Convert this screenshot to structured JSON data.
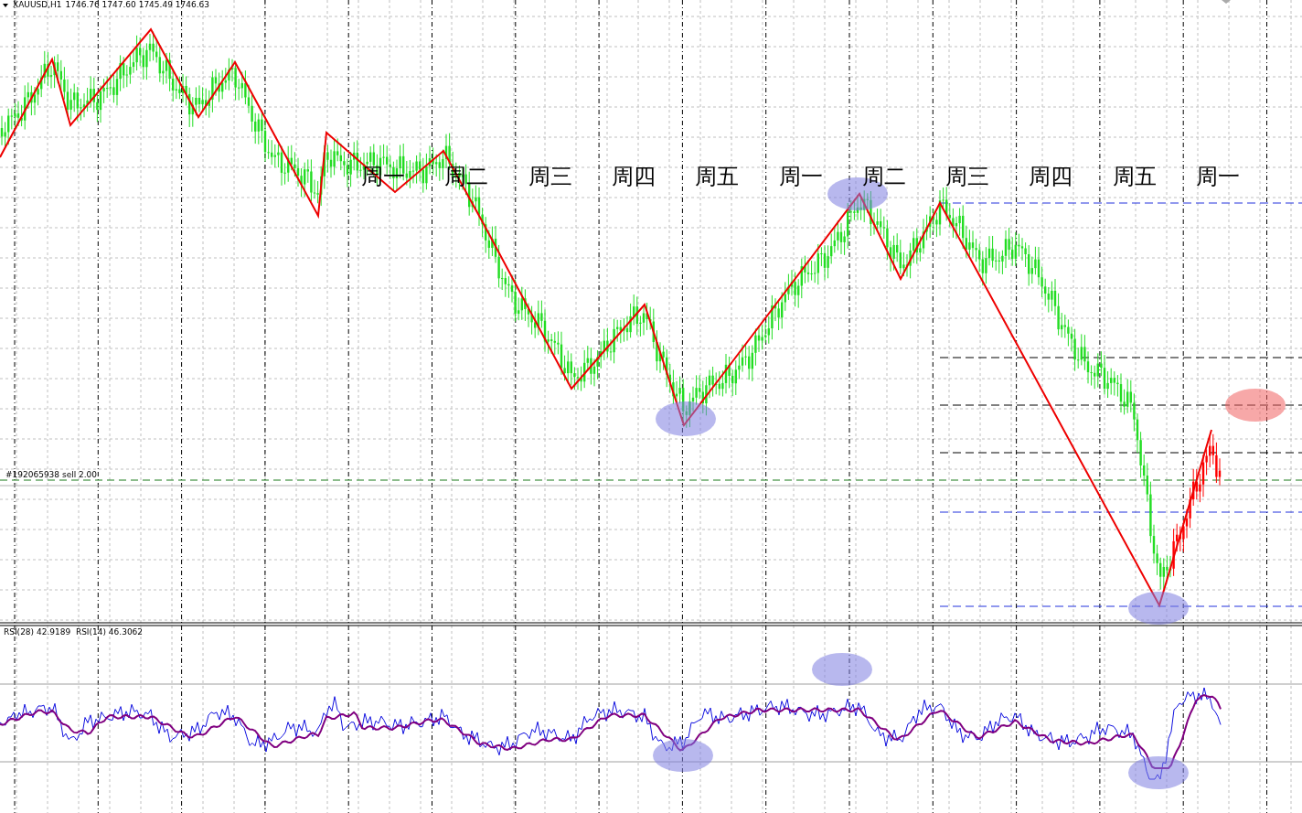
{
  "chart_header": {
    "symbol": "XAUUSD,H1",
    "quotes": "1746.76 1747.60 1745.49 1746.63"
  },
  "weekday_labels": [
    "周一",
    "周二",
    "周三",
    "周四",
    "周五",
    "周一",
    "周二",
    "周三",
    "周四",
    "周五",
    "周一"
  ],
  "order_label": "#192065938 sell 2.00",
  "indicator_label": "RSI(28) 42.9189  RSI(14) 46.3062"
}
